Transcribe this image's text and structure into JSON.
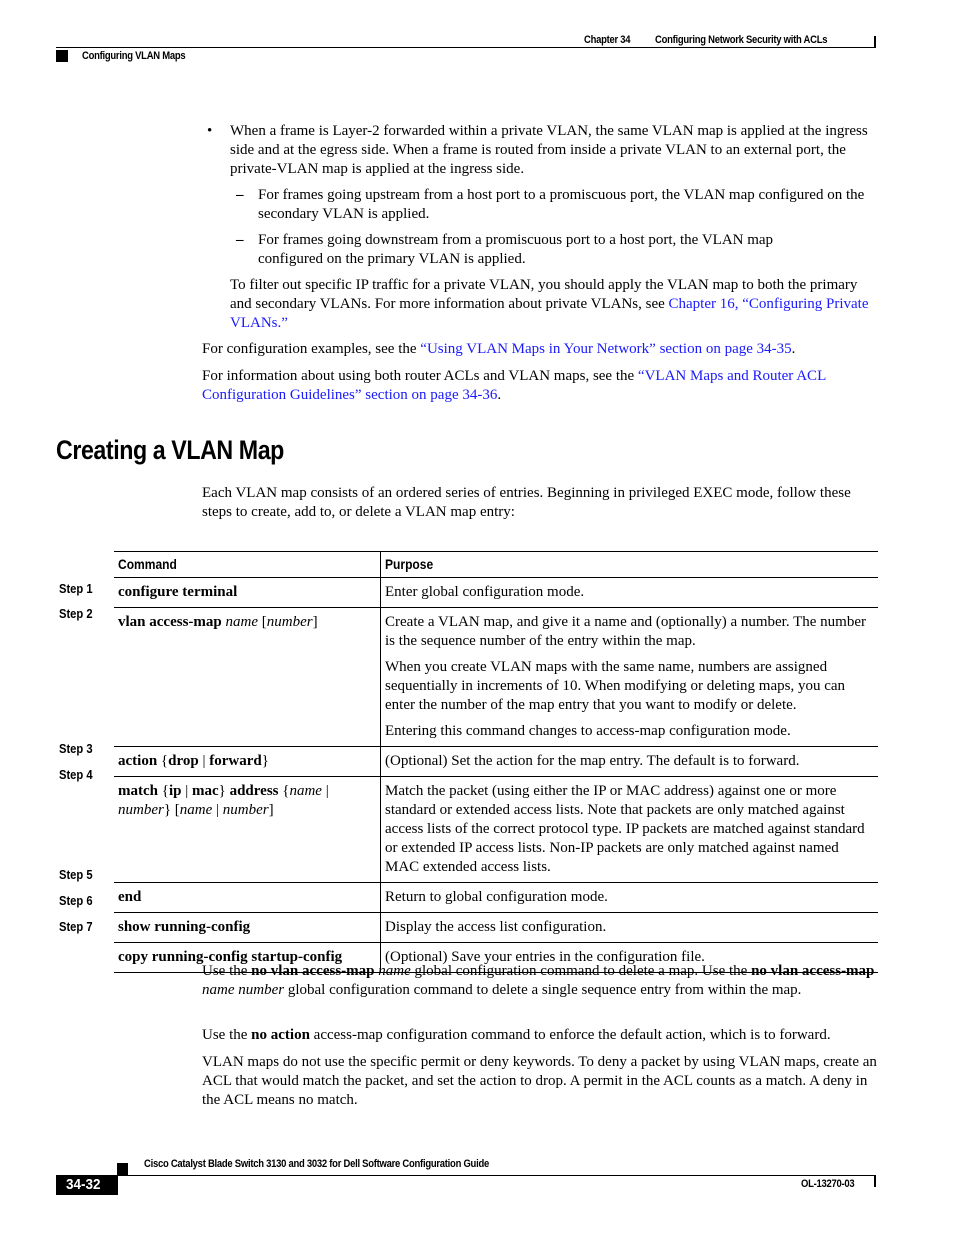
{
  "header": {
    "chapter": "Chapter 34",
    "chapter_title": "Configuring Network Security with ACLs",
    "section": "Configuring VLAN Maps"
  },
  "intro": {
    "bullet": "When a frame is Layer-2 forwarded within a private VLAN, the same VLAN map is applied at the ingress side and at the egress side. When a frame is routed from inside a private VLAN to an external port, the private-VLAN map is applied at the ingress side.",
    "dash1": "For frames going upstream from a host port to a promiscuous port, the VLAN map configured on the secondary VLAN is applied.",
    "dash2": "For frames going downstream from a promiscuous port to a host port, the VLAN map configured on the primary VLAN is applied.",
    "filter_text": "To filter out specific IP traffic for a private VLAN, you should apply the VLAN map to both the primary and secondary VLANs. For more information about private VLANs, see ",
    "filter_link": "Chapter 16, “Configuring Private VLANs.”",
    "examples_text": "For configuration examples, see the ",
    "examples_link": "“Using VLAN Maps in Your Network” section on page 34-35",
    "examples_end": ".",
    "router_text": "For information about using both router ACLs and VLAN maps, see the ",
    "router_link": "“VLAN Maps and Router ACL Configuration Guidelines” section on page 34-36",
    "router_end": "."
  },
  "section": {
    "title": "Creating a VLAN Map",
    "intro": "Each VLAN map consists of an ordered series of entries. Beginning in privileged EXEC mode, follow these steps to create, add to, or delete a VLAN map entry:"
  },
  "table": {
    "headers": {
      "command": "Command",
      "purpose": "Purpose"
    },
    "steps": [
      {
        "label": "Step 1",
        "purpose": [
          "Enter global configuration mode."
        ]
      },
      {
        "label": "Step 2",
        "purpose": [
          "Create a VLAN map, and give it a name and (optionally) a number. The number is the sequence number of the entry within the map.",
          "When you create VLAN maps with the same name, numbers are assigned sequentially in increments of 10. When modifying or deleting maps, you can enter the number of the map entry that you want to modify or delete.",
          "Entering this command changes to access-map configuration mode."
        ]
      },
      {
        "label": "Step 3",
        "purpose": [
          "(Optional) Set the action for the map entry. The default is to forward."
        ]
      },
      {
        "label": "Step 4",
        "purpose": [
          "Match the packet (using either the IP or MAC address) against one or more standard or extended access lists. Note that packets are only matched against access lists of the correct protocol type. IP packets are matched against standard or extended IP access lists. Non-IP packets are only matched against named MAC extended access lists."
        ]
      },
      {
        "label": "Step 5",
        "purpose": [
          "Return to global configuration mode."
        ]
      },
      {
        "label": "Step 6",
        "purpose": [
          "Display the access list configuration."
        ]
      },
      {
        "label": "Step 7",
        "purpose": [
          "(Optional) Save your entries in the configuration file."
        ]
      }
    ],
    "commands": {
      "s1": "configure terminal",
      "s2_cmd": "vlan access-map",
      "s2_name": "name",
      "s2_num": "number",
      "s3_cmd": "action",
      "s3_drop": "drop",
      "s3_fwd": "forward",
      "s4_match": "match",
      "s4_ip": "ip",
      "s4_mac": "mac",
      "s4_addr": "address",
      "s4_name": "name",
      "s4_number": "number",
      "s5": "end",
      "s6": "show running-config",
      "s7": "copy running-config startup-config"
    }
  },
  "after": {
    "p1_a": "Use the ",
    "p1_b": "no vlan access-map",
    "p1_c": "name",
    "p1_d": " global configuration command to delete a map. Use the ",
    "p1_e": "no vlan access-map",
    "p1_f": "name number",
    "p1_g": " global configuration command to delete a single sequence entry from within the map.",
    "p2_a": "Use the ",
    "p2_b": "no action",
    "p2_c": " access-map configuration command to enforce the default action, which is to forward.",
    "p3": "VLAN maps do not use the specific permit or deny keywords. To deny a packet by using VLAN maps, create an ACL that would match the packet, and set the action to drop. A permit in the ACL counts as a match. A deny in the ACL means no match."
  },
  "footer": {
    "guide_title": "Cisco Catalyst Blade Switch 3130 and 3032 for Dell Software Configuration Guide",
    "page_number": "34-32",
    "doc_id": "OL-13270-03"
  },
  "colors": {
    "link": "#1a1aff"
  }
}
